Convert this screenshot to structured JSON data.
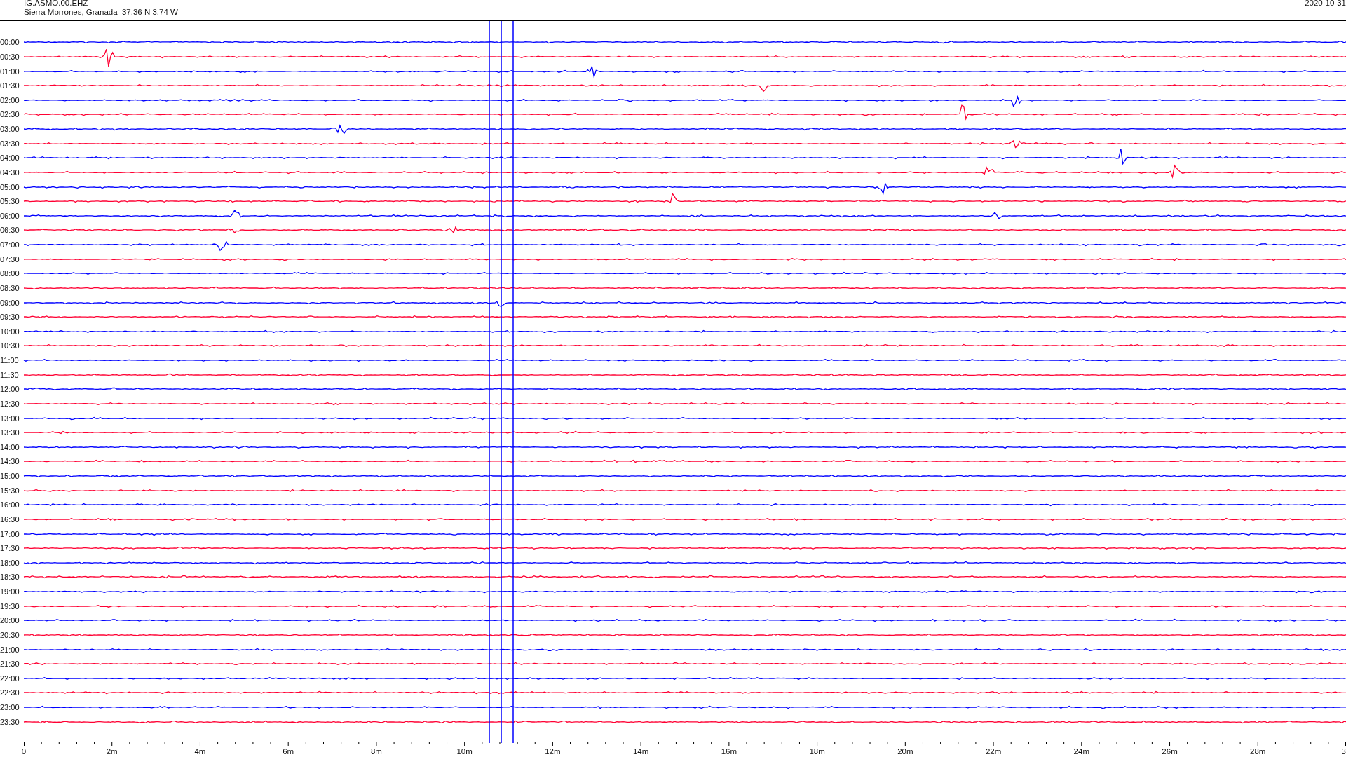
{
  "header": {
    "station": "IG.ASMO.00.EHZ",
    "location": "Sierra Morrones, Granada  37.36 N 3.74 W",
    "date": "2020-10-31"
  },
  "rows": [
    {
      "label": "00:00",
      "color": "#0000ff"
    },
    {
      "label": "00:30",
      "color": "#ff0033"
    },
    {
      "label": "01:00",
      "color": "#0000ff"
    },
    {
      "label": "01:30",
      "color": "#ff0033"
    },
    {
      "label": "02:00",
      "color": "#0000ff"
    },
    {
      "label": "02:30",
      "color": "#ff0033"
    },
    {
      "label": "03:00",
      "color": "#0000ff"
    },
    {
      "label": "03:30",
      "color": "#ff0033"
    },
    {
      "label": "04:00",
      "color": "#0000ff"
    },
    {
      "label": "04:30",
      "color": "#ff0033"
    },
    {
      "label": "05:00",
      "color": "#0000ff"
    },
    {
      "label": "05:30",
      "color": "#ff0033"
    },
    {
      "label": "06:00",
      "color": "#0000ff"
    },
    {
      "label": "06:30",
      "color": "#ff0033"
    },
    {
      "label": "07:00",
      "color": "#0000ff"
    },
    {
      "label": "07:30",
      "color": "#ff0033"
    },
    {
      "label": "08:00",
      "color": "#0000ff"
    },
    {
      "label": "08:30",
      "color": "#ff0033"
    },
    {
      "label": "09:00",
      "color": "#0000ff"
    },
    {
      "label": "09:30",
      "color": "#ff0033"
    },
    {
      "label": "10:00",
      "color": "#0000ff"
    },
    {
      "label": "10:30",
      "color": "#ff0033"
    },
    {
      "label": "11:00",
      "color": "#0000ff"
    },
    {
      "label": "11:30",
      "color": "#ff0033"
    },
    {
      "label": "12:00",
      "color": "#0000ff"
    },
    {
      "label": "12:30",
      "color": "#ff0033"
    },
    {
      "label": "13:00",
      "color": "#0000ff"
    },
    {
      "label": "13:30",
      "color": "#ff0033"
    },
    {
      "label": "14:00",
      "color": "#0000ff"
    },
    {
      "label": "14:30",
      "color": "#ff0033"
    },
    {
      "label": "15:00",
      "color": "#0000ff"
    },
    {
      "label": "15:30",
      "color": "#ff0033"
    },
    {
      "label": "16:00",
      "color": "#0000ff"
    },
    {
      "label": "16:30",
      "color": "#ff0033"
    },
    {
      "label": "17:00",
      "color": "#0000ff"
    },
    {
      "label": "17:30",
      "color": "#ff0033"
    },
    {
      "label": "18:00",
      "color": "#0000ff"
    },
    {
      "label": "18:30",
      "color": "#ff0033"
    },
    {
      "label": "19:00",
      "color": "#0000ff"
    },
    {
      "label": "19:30",
      "color": "#ff0033"
    },
    {
      "label": "20:00",
      "color": "#0000ff"
    },
    {
      "label": "20:30",
      "color": "#ff0033"
    },
    {
      "label": "21:00",
      "color": "#0000ff"
    },
    {
      "label": "21:30",
      "color": "#ff0033"
    },
    {
      "label": "22:00",
      "color": "#0000ff"
    },
    {
      "label": "22:30",
      "color": "#ff0033"
    },
    {
      "label": "23:00",
      "color": "#0000ff"
    },
    {
      "label": "23:30",
      "color": "#ff0033"
    }
  ],
  "x_axis": {
    "labels": [
      "0",
      "2m",
      "4m",
      "6m",
      "8m",
      "10m",
      "12m",
      "14m",
      "16m",
      "18m",
      "20m",
      "22m",
      "24m",
      "26m",
      "28m",
      "3"
    ]
  }
}
